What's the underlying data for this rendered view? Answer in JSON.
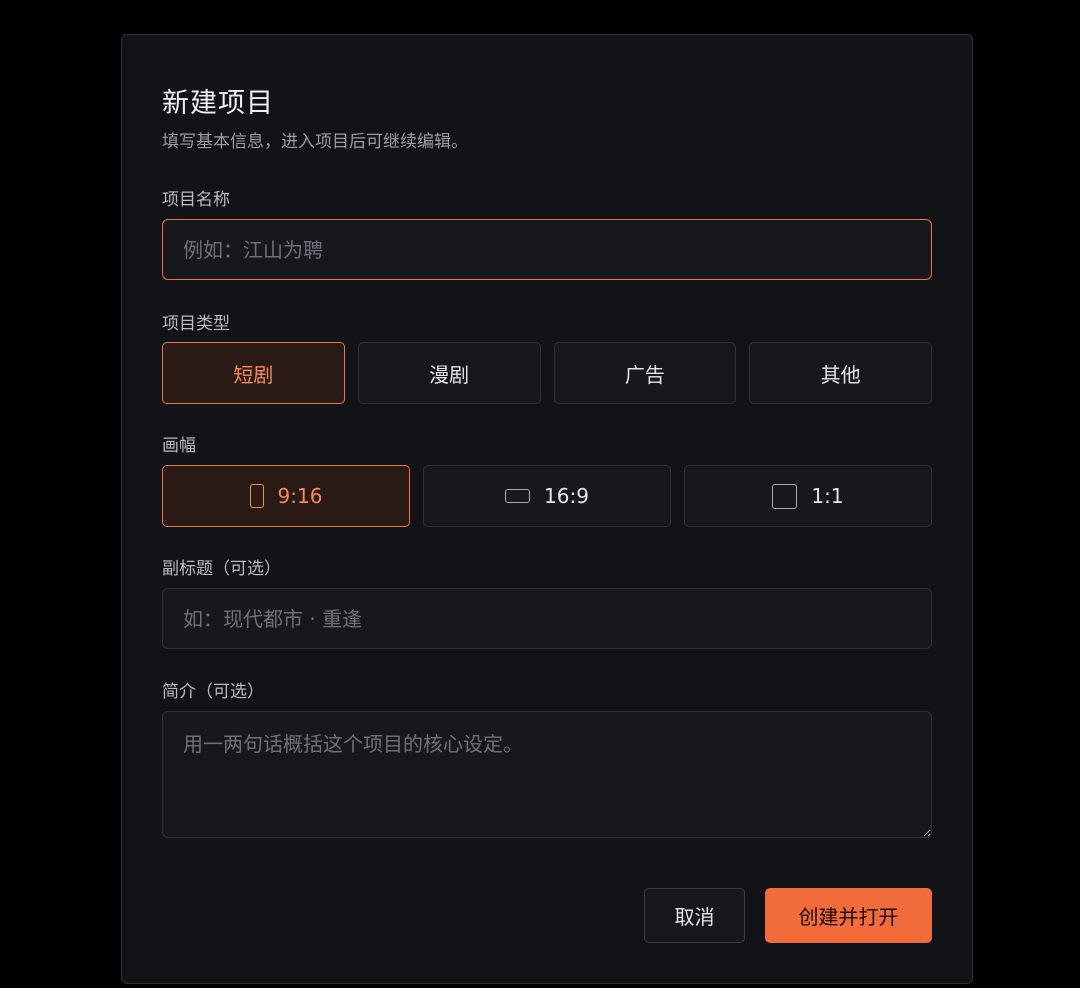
{
  "dialog": {
    "title": "新建项目",
    "subtitle": "填写基本信息，进入项目后可继续编辑。"
  },
  "project_name": {
    "label": "项目名称",
    "value": "",
    "placeholder": "例如：江山为聘"
  },
  "project_type": {
    "label": "项目类型",
    "options": [
      "短剧",
      "漫剧",
      "广告",
      "其他"
    ],
    "selected": "短剧"
  },
  "aspect_ratio": {
    "label": "画幅",
    "options": [
      {
        "label": "9:16",
        "icon": "portrait-ratio-icon"
      },
      {
        "label": "16:9",
        "icon": "landscape-ratio-icon"
      },
      {
        "label": "1:1",
        "icon": "square-ratio-icon"
      }
    ],
    "selected": "9:16"
  },
  "subtitle_field": {
    "label": "副标题（可选）",
    "value": "",
    "placeholder": "如：现代都市 · 重逢"
  },
  "intro_field": {
    "label": "简介（可选）",
    "value": "",
    "placeholder": "用一两句话概括这个项目的核心设定。"
  },
  "actions": {
    "cancel_label": "取消",
    "create_label": "创建并打开"
  },
  "colors": {
    "accent": "#f26b3a",
    "background": "#000000",
    "dialog": "#121317"
  }
}
